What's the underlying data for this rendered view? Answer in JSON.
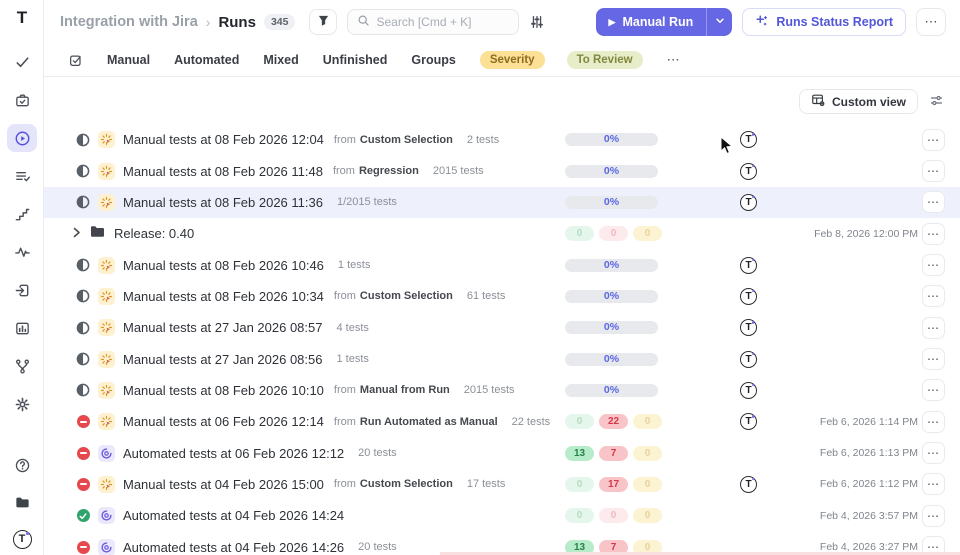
{
  "labels": {
    "from_word": "from"
  },
  "icons": {
    "more_h": "⋯",
    "breadcrumb_sep": "›",
    "play": "▶",
    "logo_letter": "T",
    "avatar_letter": "T",
    "help_mark": "?"
  },
  "header": {
    "breadcrumb_project": "Integration with Jira",
    "breadcrumb_page": "Runs",
    "count_badge": "345",
    "search_placeholder": "Search [Cmd + K]",
    "manual_run_label": "Manual Run",
    "runs_status_report_label": "Runs Status Report"
  },
  "filters": {
    "tabs": [
      "Manual",
      "Automated",
      "Mixed",
      "Unfinished",
      "Groups"
    ],
    "pills": [
      {
        "label": "Severity",
        "variant": "severity"
      },
      {
        "label": "To Review",
        "variant": "to-review"
      }
    ]
  },
  "toolbar": {
    "custom_view_label": "Custom view"
  },
  "sidebar": {
    "top_icons": [
      "tests-check-icon",
      "test-plan-icon",
      "runs-play-icon",
      "checklist-icon",
      "steps-icon",
      "activity-icon",
      "import-icon",
      "analytics-icon",
      "branch-icon",
      "settings-gear-icon"
    ],
    "active_icon": "runs-play-icon",
    "bottom_icons": [
      "help-icon",
      "projects-folder-icon",
      "account-avatar"
    ]
  },
  "rows": [
    {
      "kind": "manual",
      "status": "progress",
      "title": "Manual tests at 08 Feb 2026 12:04",
      "from": "Custom Selection",
      "tests": "2 tests",
      "progress": "0%",
      "avatar": true
    },
    {
      "kind": "manual",
      "status": "progress",
      "title": "Manual tests at 08 Feb 2026 11:48",
      "from": "Regression",
      "tests": "2015 tests",
      "progress": "0%",
      "avatar": true
    },
    {
      "kind": "manual",
      "status": "progress",
      "title": "Manual tests at 08 Feb 2026 11:36",
      "tests": "1/2015 tests",
      "progress": "0%",
      "avatar": true,
      "highlighted": true
    },
    {
      "kind": "group",
      "title": "Release: 0.40",
      "badges": [
        {
          "value": "0",
          "variant": "pg"
        },
        {
          "value": "0",
          "variant": "pr"
        },
        {
          "value": "0",
          "variant": "py"
        }
      ],
      "date": "Feb 8, 2026 12:00 PM"
    },
    {
      "kind": "manual",
      "status": "progress",
      "title": "Manual tests at 08 Feb 2026 10:46",
      "tests": "1 tests",
      "progress": "0%",
      "avatar": true
    },
    {
      "kind": "manual",
      "status": "progress",
      "title": "Manual tests at 08 Feb 2026 10:34",
      "from": "Custom Selection",
      "tests": "61 tests",
      "progress": "0%",
      "avatar": true
    },
    {
      "kind": "manual",
      "status": "progress",
      "title": "Manual tests at 27 Jan 2026 08:57",
      "tests": "4 tests",
      "progress": "0%",
      "avatar": true
    },
    {
      "kind": "manual",
      "status": "progress",
      "title": "Manual tests at 27 Jan 2026 08:56",
      "tests": "1 tests",
      "progress": "0%",
      "avatar": true
    },
    {
      "kind": "manual",
      "status": "progress",
      "title": "Manual tests at 08 Feb 2026 10:10",
      "from": "Manual from Run",
      "tests": "2015 tests",
      "progress": "0%",
      "avatar": true
    },
    {
      "kind": "manual",
      "status": "failed",
      "title": "Manual tests at 06 Feb 2026 12:14",
      "from": "Run Automated as Manual",
      "tests": "22 tests",
      "badges": [
        {
          "value": "0",
          "variant": "pg"
        },
        {
          "value": "22",
          "variant": "r"
        },
        {
          "value": "0",
          "variant": "py"
        }
      ],
      "avatar": true,
      "date": "Feb 6, 2026 1:14 PM"
    },
    {
      "kind": "automated",
      "status": "failed",
      "title": "Automated tests at 06 Feb 2026 12:12",
      "tests": "20 tests",
      "badges": [
        {
          "value": "13",
          "variant": "g"
        },
        {
          "value": "7",
          "variant": "r"
        },
        {
          "value": "0",
          "variant": "py"
        }
      ],
      "date": "Feb 6, 2026 1:13 PM"
    },
    {
      "kind": "manual",
      "status": "failed",
      "title": "Manual tests at 04 Feb 2026 15:00",
      "from": "Custom Selection",
      "tests": "17 tests",
      "badges": [
        {
          "value": "0",
          "variant": "pg"
        },
        {
          "value": "17",
          "variant": "r"
        },
        {
          "value": "0",
          "variant": "py"
        }
      ],
      "avatar": true,
      "date": "Feb 6, 2026 1:12 PM"
    },
    {
      "kind": "automated",
      "status": "passed",
      "title": "Automated tests at 04 Feb 2026 14:24",
      "badges": [
        {
          "value": "0",
          "variant": "pg"
        },
        {
          "value": "0",
          "variant": "pr"
        },
        {
          "value": "0",
          "variant": "py"
        }
      ],
      "date": "Feb 4, 2026 3:57 PM"
    },
    {
      "kind": "automated",
      "status": "failed",
      "title": "Automated tests at 04 Feb 2026 14:26",
      "tests": "20 tests",
      "badges": [
        {
          "value": "13",
          "variant": "g"
        },
        {
          "value": "7",
          "variant": "r"
        },
        {
          "value": "0",
          "variant": "py"
        }
      ],
      "date": "Feb 4, 2026 3:27 PM"
    }
  ]
}
